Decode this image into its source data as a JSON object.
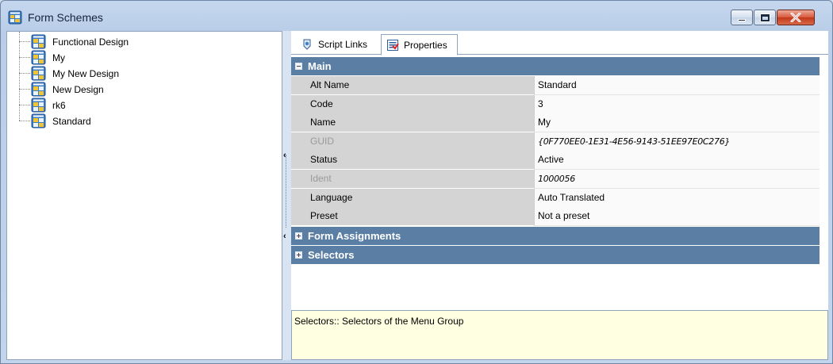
{
  "window": {
    "title": "Form Schemes",
    "icon": "form-scheme-icon"
  },
  "tree": {
    "items": [
      {
        "label": "Functional Design",
        "icon": "form-scheme-icon"
      },
      {
        "label": "My",
        "icon": "form-scheme-icon"
      },
      {
        "label": "My New Design",
        "icon": "form-scheme-icon"
      },
      {
        "label": "New Design",
        "icon": "form-scheme-icon"
      },
      {
        "label": "rk6",
        "icon": "form-scheme-icon"
      },
      {
        "label": "Standard",
        "icon": "form-scheme-icon"
      }
    ]
  },
  "tabs": [
    {
      "label": "Script Links",
      "icon": "script-links-icon",
      "active": false
    },
    {
      "label": "Properties",
      "icon": "properties-icon",
      "active": true
    }
  ],
  "properties": {
    "main_section": "Main",
    "rows": [
      {
        "name": "Alt Name",
        "value": "Standard"
      },
      {
        "name": "Code",
        "value": "3"
      },
      {
        "name": "Name",
        "value": "My"
      },
      {
        "name": "GUID",
        "value": "{0F770EE0-1E31-4E56-9143-51EE97E0C276}"
      },
      {
        "name": "Status",
        "value": "Active"
      },
      {
        "name": "Ident",
        "value": "1000056"
      },
      {
        "name": "Language",
        "value": "Auto Translated"
      },
      {
        "name": "Preset",
        "value": "Not a preset"
      }
    ],
    "sections": [
      "Form Assignments",
      "Selectors"
    ]
  },
  "description": "Selectors:: Selectors of the Menu Group",
  "colors": {
    "section_header": "#5b7fa4",
    "description_bg": "#ffffe1",
    "close_button": "#c2381a"
  }
}
